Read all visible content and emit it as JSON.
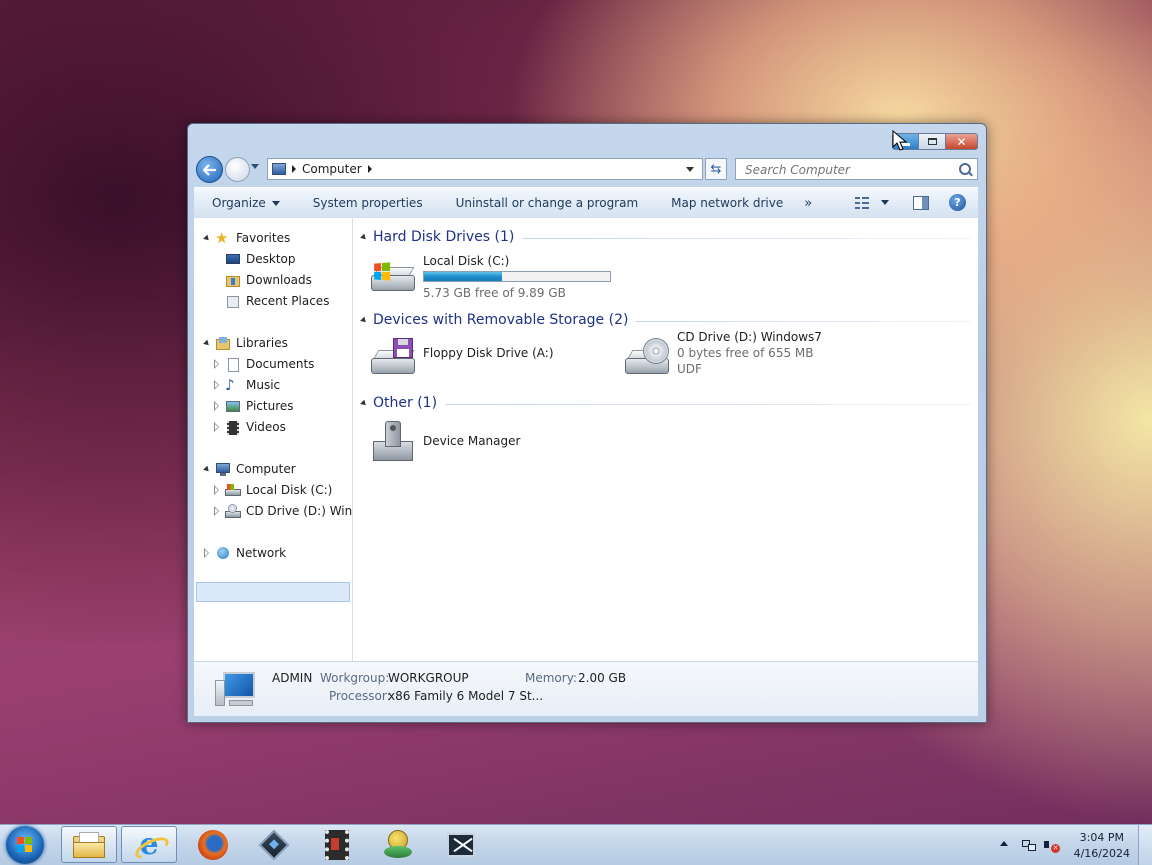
{
  "window": {
    "address": {
      "path": "Computer"
    },
    "search": {
      "placeholder": "Search Computer"
    }
  },
  "toolbar": {
    "organize": "Organize",
    "system_properties": "System properties",
    "uninstall": "Uninstall or change a program",
    "map_drive": "Map network drive",
    "more": "»",
    "help": "?"
  },
  "nav": {
    "favorites": "Favorites",
    "desktop": "Desktop",
    "downloads": "Downloads",
    "recent": "Recent Places",
    "libraries": "Libraries",
    "documents": "Documents",
    "music": "Music",
    "pictures": "Pictures",
    "videos": "Videos",
    "computer": "Computer",
    "local_disk": "Local Disk (C:)",
    "cd_drive": "CD Drive (D:) Windo",
    "network": "Network"
  },
  "groups": {
    "hard_disks": {
      "title": "Hard Disk Drives (1)",
      "local_disk": {
        "name": "Local Disk (C:)",
        "free": "5.73 GB free of 9.89 GB",
        "used_fraction": 0.42
      }
    },
    "removable": {
      "title": "Devices with Removable Storage (2)",
      "floppy": {
        "name": "Floppy Disk Drive (A:)"
      },
      "cd": {
        "name": "CD Drive (D:) Windows7",
        "free": "0 bytes free of 655 MB",
        "fs": "UDF"
      }
    },
    "other": {
      "title": "Other (1)",
      "device_manager": {
        "name": "Device Manager"
      }
    }
  },
  "details": {
    "name": "ADMIN",
    "workgroup_label": "Workgroup:",
    "workgroup": "WORKGROUP",
    "memory_label": "Memory:",
    "memory": "2.00 GB",
    "processor_label": "Processor:",
    "processor": "x86 Family 6 Model 7 St..."
  },
  "taskbar": {
    "time": "3:04 PM",
    "date": "4/16/2024"
  },
  "colors": {
    "group_title": "#1e3287",
    "progress": "#1b8ac9",
    "accent": "#2f7fc8"
  }
}
